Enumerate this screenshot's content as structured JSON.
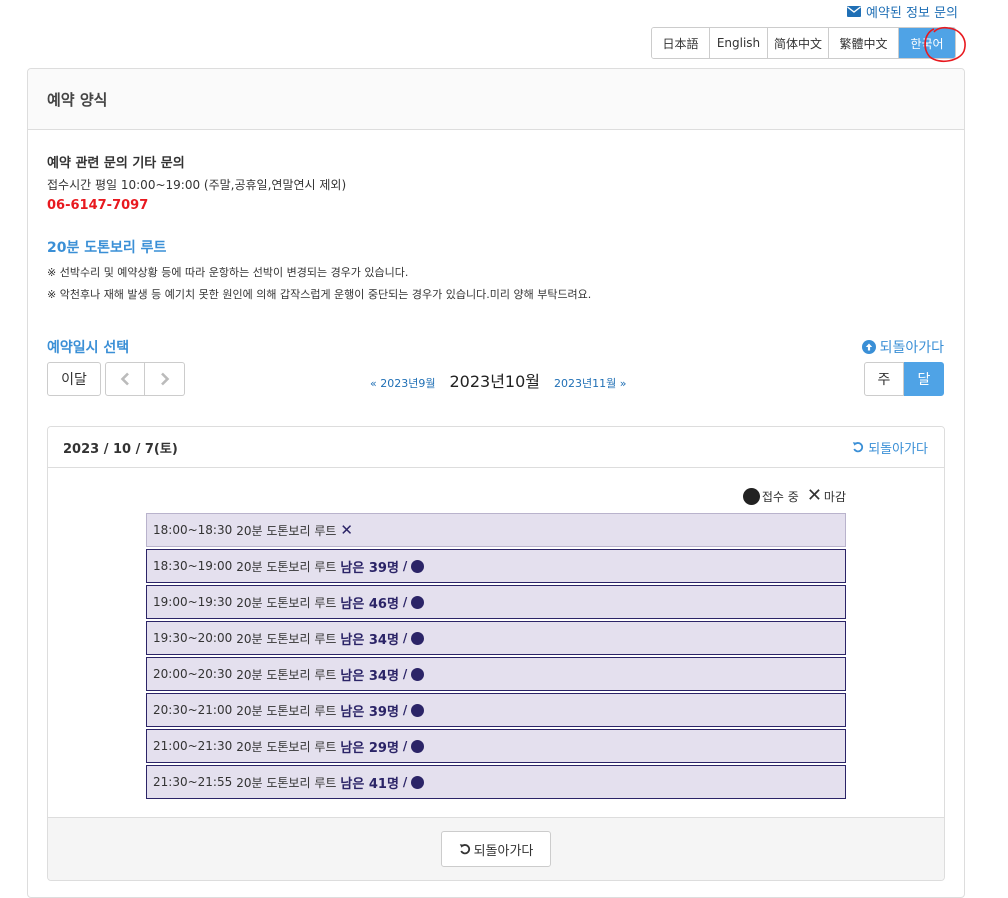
{
  "header": {
    "inquiry_link": "예약된 정보 문의",
    "languages": [
      {
        "label": "日本語",
        "active": false
      },
      {
        "label": "English",
        "active": false
      },
      {
        "label": "简体中文",
        "active": false
      },
      {
        "label": "繁體中文",
        "active": false
      },
      {
        "label": "한국어",
        "active": true
      }
    ]
  },
  "panel": {
    "title": "예약 양식",
    "contact": {
      "title": "예약 관련 문의 기타 문의",
      "hours": "접수시간 평일 10:00~19:00 (주말,공휴일,연말연시 제외)",
      "phone": "06-6147-7097"
    },
    "route": {
      "title": "20분 도톤보리 루트",
      "notes": [
        "※ 선박수리 및 예약상황 등에 따라 운항하는 선박이 변경되는 경우가 있습니다.",
        "※ 악천후나 재해 발생 등 예기치 못한 원인에 의해 갑작스럽게 운행이 중단되는 경우가 있습니다.미리 양해 부탁드려요."
      ]
    },
    "select_title": "예약일시 선택",
    "back_label": "되돌아가다"
  },
  "calendar": {
    "this_month": "이달",
    "prev_month": "« 2023년9월",
    "current_month": "2023년10월",
    "next_month": "2023년11월 »",
    "view_week": "주",
    "view_month": "달",
    "active_view": "month"
  },
  "day": {
    "date": "2023 / 10 / 7(토)",
    "back_label": "되돌아가다",
    "legend": {
      "open": "접수 중",
      "closed": "마감"
    },
    "slots": [
      {
        "time": "18:00~18:30",
        "route": "20분 도톤보리 루트",
        "status": "closed",
        "remaining": ""
      },
      {
        "time": "18:30~19:00",
        "route": "20분 도톤보리 루트",
        "status": "open",
        "remaining": "남은 39명"
      },
      {
        "time": "19:00~19:30",
        "route": "20분 도톤보리 루트",
        "status": "open",
        "remaining": "남은 46명"
      },
      {
        "time": "19:30~20:00",
        "route": "20분 도톤보리 루트",
        "status": "open",
        "remaining": "남은 34명"
      },
      {
        "time": "20:00~20:30",
        "route": "20분 도톤보리 루트",
        "status": "open",
        "remaining": "남은 34명"
      },
      {
        "time": "20:30~21:00",
        "route": "20분 도톤보리 루트",
        "status": "open",
        "remaining": "남은 39명"
      },
      {
        "time": "21:00~21:30",
        "route": "20분 도톤보리 루트",
        "status": "open",
        "remaining": "남은 29명"
      },
      {
        "time": "21:30~21:55",
        "route": "20분 도톤보리 루트",
        "status": "open",
        "remaining": "남은 41명"
      }
    ],
    "footer_back": "되돌아가다"
  },
  "colors": {
    "accent": "#4fa3e6",
    "link": "#3a8fd6",
    "phone": "#e8191f",
    "slot_border": "#2b2467",
    "slot_bg": "#e4e0ee"
  }
}
